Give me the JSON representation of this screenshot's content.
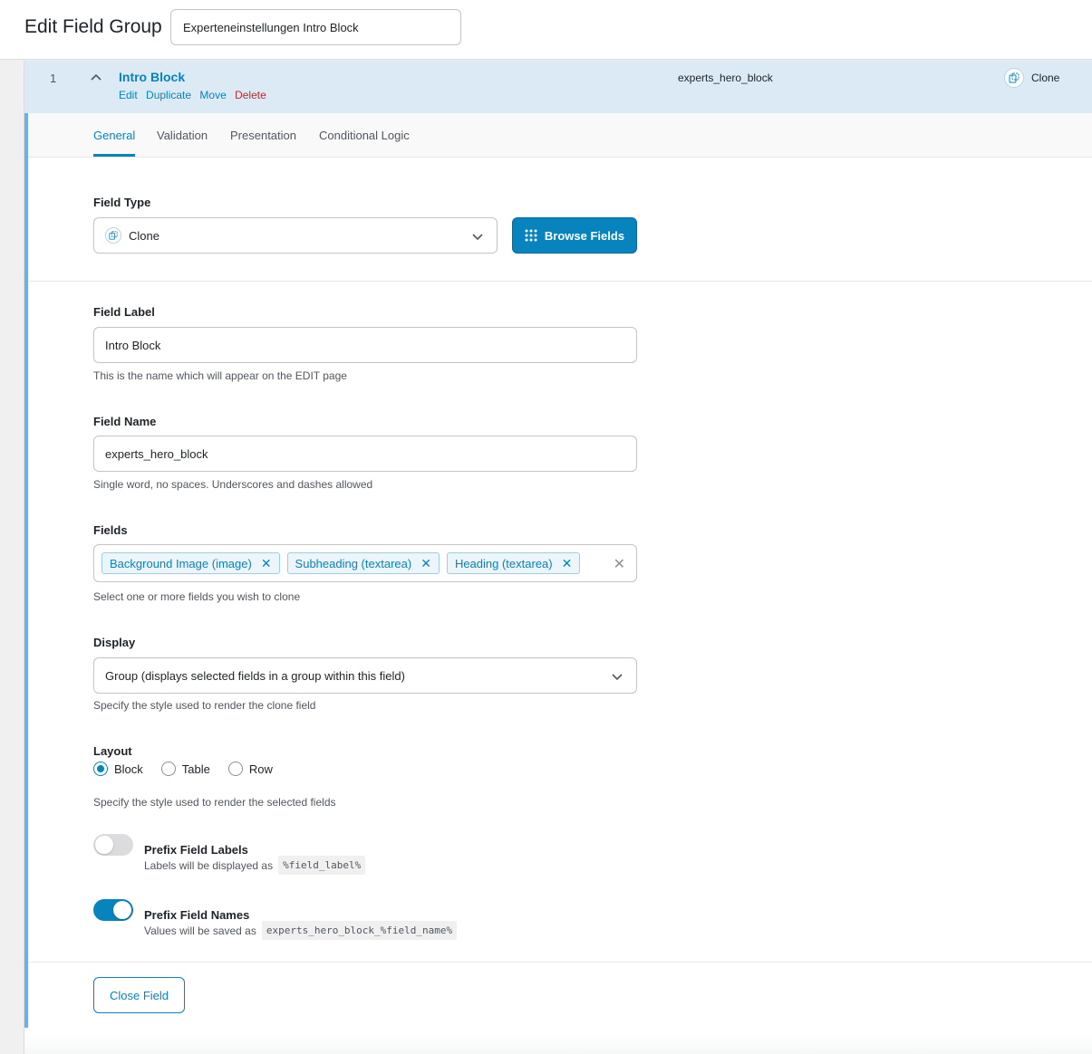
{
  "page": {
    "title": "Edit Field Group",
    "group_title_value": "Experteneinstellungen Intro Block"
  },
  "field_header": {
    "order": "1",
    "label": "Intro Block",
    "actions": {
      "edit": "Edit",
      "duplicate": "Duplicate",
      "move": "Move",
      "delete": "Delete"
    },
    "name": "experts_hero_block",
    "type": "Clone"
  },
  "tabs": [
    "General",
    "Validation",
    "Presentation",
    "Conditional Logic"
  ],
  "field_type": {
    "label": "Field Type",
    "value": "Clone",
    "browse_label": "Browse Fields"
  },
  "field_label": {
    "label": "Field Label",
    "value": "Intro Block",
    "hint": "This is the name which will appear on the EDIT page"
  },
  "field_name": {
    "label": "Field Name",
    "value": "experts_hero_block",
    "hint": "Single word, no spaces. Underscores and dashes allowed"
  },
  "fields": {
    "label": "Fields",
    "tags": [
      "Background Image (image)",
      "Subheading (textarea)",
      "Heading (textarea)"
    ],
    "hint": "Select one or more fields you wish to clone"
  },
  "display": {
    "label": "Display",
    "value": "Group (displays selected fields in a group within this field)",
    "hint": "Specify the style used to render the clone field"
  },
  "layout": {
    "label": "Layout",
    "options": [
      "Block",
      "Table",
      "Row"
    ],
    "selected": "Block",
    "hint": "Specify the style used to render the selected fields"
  },
  "prefix_labels": {
    "title": "Prefix Field Labels",
    "desc": "Labels will be displayed as",
    "code": "%field_label%",
    "enabled": false
  },
  "prefix_names": {
    "title": "Prefix Field Names",
    "desc": "Values will be saved as",
    "code": "experts_hero_block_%field_name%",
    "enabled": true
  },
  "close_label": "Close Field",
  "colors": {
    "accent": "#0783be",
    "header_bg": "#dbeaf5",
    "delete": "#b32d2e"
  }
}
